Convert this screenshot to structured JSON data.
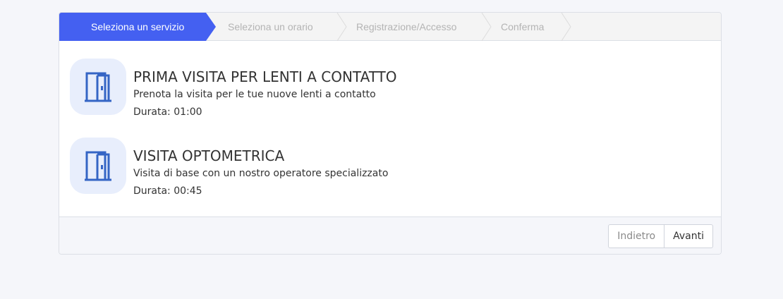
{
  "steps": [
    {
      "label": "Seleziona un servizio",
      "active": true
    },
    {
      "label": "Seleziona un orario",
      "active": false
    },
    {
      "label": "Registrazione/Accesso",
      "active": false
    },
    {
      "label": "Conferma",
      "active": false
    }
  ],
  "services": [
    {
      "icon": "door-icon",
      "title": "PRIMA VISITA PER LENTI A CONTATTO",
      "description": "Prenota la visita per le tue nuove lenti a contatto",
      "duration": "Durata: 01:00"
    },
    {
      "icon": "door-icon",
      "title": "VISITA OPTOMETRICA",
      "description": "Visita di base con un nostro operatore specializzato",
      "duration": "Durata: 00:45"
    }
  ],
  "footer": {
    "back_label": "Indietro",
    "next_label": "Avanti"
  },
  "colors": {
    "accent": "#4460f1",
    "icon": "#3565c5",
    "icon_bg": "#e8eefc"
  }
}
